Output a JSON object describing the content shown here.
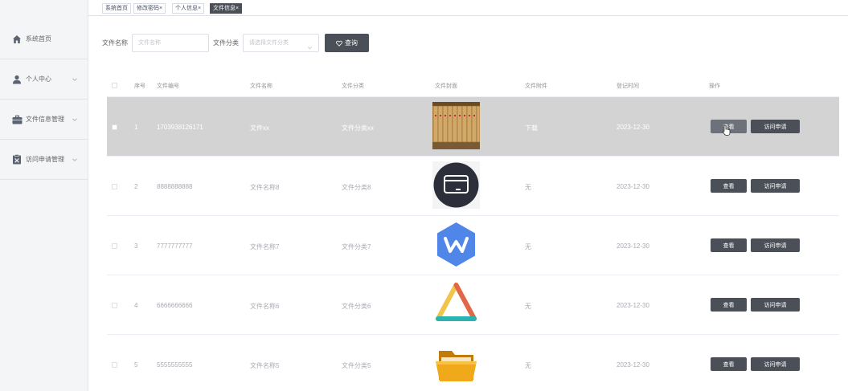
{
  "tabs": [
    {
      "label": "系统首页",
      "closable": false,
      "active": false
    },
    {
      "label": "修改密码",
      "closable": true,
      "active": false
    },
    {
      "label": "个人信息",
      "closable": true,
      "active": false
    },
    {
      "label": "文件信息",
      "closable": true,
      "active": true
    }
  ],
  "close_glyph": "×",
  "sidebar": {
    "items": [
      {
        "label": "系统首页",
        "icon": "home-icon"
      },
      {
        "label": "个人中心",
        "icon": "user-icon",
        "expandable": true
      },
      {
        "label": "文件信息管理",
        "icon": "briefcase-icon",
        "expandable": true
      },
      {
        "label": "访问申请管理",
        "icon": "clipboard-icon",
        "expandable": true
      }
    ]
  },
  "search": {
    "name_label": "文件名称",
    "name_placeholder": "文件名称",
    "category_label": "文件分类",
    "category_placeholder": "请选择文件分类",
    "button_label": "查询"
  },
  "table": {
    "headers": [
      "序号",
      "文件编号",
      "文件名称",
      "文件分类",
      "文件封面",
      "文件附件",
      "登记时间",
      "操作"
    ],
    "rows": [
      {
        "index": "1",
        "code": "1703938126171",
        "name": "文件xx",
        "category": "文件分类xx",
        "cover": "archive-folders",
        "attachment": "下载",
        "attachment_is_link": true,
        "date": "2023-12-30",
        "view": "查看",
        "apply": "访问申请",
        "hover": true
      },
      {
        "index": "2",
        "code": "8888888888",
        "name": "文件名称8",
        "category": "文件分类8",
        "cover": "card-circle",
        "attachment": "无",
        "attachment_is_link": false,
        "date": "2023-12-30",
        "view": "查看",
        "apply": "访问申请",
        "hover": false
      },
      {
        "index": "3",
        "code": "7777777777",
        "name": "文件名称7",
        "category": "文件分类7",
        "cover": "wps-hexagon",
        "attachment": "无",
        "attachment_is_link": false,
        "date": "2023-12-30",
        "view": "查看",
        "apply": "访问申请",
        "hover": false
      },
      {
        "index": "4",
        "code": "6666666666",
        "name": "文件名称6",
        "category": "文件分类6",
        "cover": "triangle-logo",
        "attachment": "无",
        "attachment_is_link": false,
        "date": "2023-12-30",
        "view": "查看",
        "apply": "访问申请",
        "hover": false
      },
      {
        "index": "5",
        "code": "5555555555",
        "name": "文件名称5",
        "category": "文件分类5",
        "cover": "yellow-folder",
        "attachment": "无",
        "attachment_is_link": false,
        "date": "2023-12-30",
        "view": "查看",
        "apply": "访问申请",
        "hover": false
      }
    ]
  },
  "colors": {
    "accent": "#4a4f58",
    "hover_row": "#d3d3d3",
    "link": "#3db28f"
  }
}
